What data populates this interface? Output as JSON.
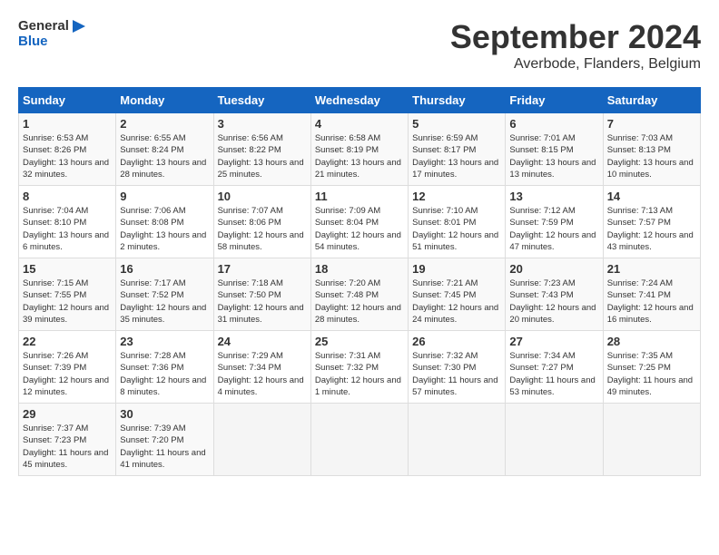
{
  "header": {
    "logo_line1": "General",
    "logo_line2": "Blue",
    "month": "September 2024",
    "location": "Averbode, Flanders, Belgium"
  },
  "days_of_week": [
    "Sunday",
    "Monday",
    "Tuesday",
    "Wednesday",
    "Thursday",
    "Friday",
    "Saturday"
  ],
  "weeks": [
    [
      {
        "day": "1",
        "sunrise": "6:53 AM",
        "sunset": "8:26 PM",
        "daylight": "13 hours and 32 minutes."
      },
      {
        "day": "2",
        "sunrise": "6:55 AM",
        "sunset": "8:24 PM",
        "daylight": "13 hours and 28 minutes."
      },
      {
        "day": "3",
        "sunrise": "6:56 AM",
        "sunset": "8:22 PM",
        "daylight": "13 hours and 25 minutes."
      },
      {
        "day": "4",
        "sunrise": "6:58 AM",
        "sunset": "8:19 PM",
        "daylight": "13 hours and 21 minutes."
      },
      {
        "day": "5",
        "sunrise": "6:59 AM",
        "sunset": "8:17 PM",
        "daylight": "13 hours and 17 minutes."
      },
      {
        "day": "6",
        "sunrise": "7:01 AM",
        "sunset": "8:15 PM",
        "daylight": "13 hours and 13 minutes."
      },
      {
        "day": "7",
        "sunrise": "7:03 AM",
        "sunset": "8:13 PM",
        "daylight": "13 hours and 10 minutes."
      }
    ],
    [
      {
        "day": "8",
        "sunrise": "7:04 AM",
        "sunset": "8:10 PM",
        "daylight": "13 hours and 6 minutes."
      },
      {
        "day": "9",
        "sunrise": "7:06 AM",
        "sunset": "8:08 PM",
        "daylight": "13 hours and 2 minutes."
      },
      {
        "day": "10",
        "sunrise": "7:07 AM",
        "sunset": "8:06 PM",
        "daylight": "12 hours and 58 minutes."
      },
      {
        "day": "11",
        "sunrise": "7:09 AM",
        "sunset": "8:04 PM",
        "daylight": "12 hours and 54 minutes."
      },
      {
        "day": "12",
        "sunrise": "7:10 AM",
        "sunset": "8:01 PM",
        "daylight": "12 hours and 51 minutes."
      },
      {
        "day": "13",
        "sunrise": "7:12 AM",
        "sunset": "7:59 PM",
        "daylight": "12 hours and 47 minutes."
      },
      {
        "day": "14",
        "sunrise": "7:13 AM",
        "sunset": "7:57 PM",
        "daylight": "12 hours and 43 minutes."
      }
    ],
    [
      {
        "day": "15",
        "sunrise": "7:15 AM",
        "sunset": "7:55 PM",
        "daylight": "12 hours and 39 minutes."
      },
      {
        "day": "16",
        "sunrise": "7:17 AM",
        "sunset": "7:52 PM",
        "daylight": "12 hours and 35 minutes."
      },
      {
        "day": "17",
        "sunrise": "7:18 AM",
        "sunset": "7:50 PM",
        "daylight": "12 hours and 31 minutes."
      },
      {
        "day": "18",
        "sunrise": "7:20 AM",
        "sunset": "7:48 PM",
        "daylight": "12 hours and 28 minutes."
      },
      {
        "day": "19",
        "sunrise": "7:21 AM",
        "sunset": "7:45 PM",
        "daylight": "12 hours and 24 minutes."
      },
      {
        "day": "20",
        "sunrise": "7:23 AM",
        "sunset": "7:43 PM",
        "daylight": "12 hours and 20 minutes."
      },
      {
        "day": "21",
        "sunrise": "7:24 AM",
        "sunset": "7:41 PM",
        "daylight": "12 hours and 16 minutes."
      }
    ],
    [
      {
        "day": "22",
        "sunrise": "7:26 AM",
        "sunset": "7:39 PM",
        "daylight": "12 hours and 12 minutes."
      },
      {
        "day": "23",
        "sunrise": "7:28 AM",
        "sunset": "7:36 PM",
        "daylight": "12 hours and 8 minutes."
      },
      {
        "day": "24",
        "sunrise": "7:29 AM",
        "sunset": "7:34 PM",
        "daylight": "12 hours and 4 minutes."
      },
      {
        "day": "25",
        "sunrise": "7:31 AM",
        "sunset": "7:32 PM",
        "daylight": "12 hours and 1 minute."
      },
      {
        "day": "26",
        "sunrise": "7:32 AM",
        "sunset": "7:30 PM",
        "daylight": "11 hours and 57 minutes."
      },
      {
        "day": "27",
        "sunrise": "7:34 AM",
        "sunset": "7:27 PM",
        "daylight": "11 hours and 53 minutes."
      },
      {
        "day": "28",
        "sunrise": "7:35 AM",
        "sunset": "7:25 PM",
        "daylight": "11 hours and 49 minutes."
      }
    ],
    [
      {
        "day": "29",
        "sunrise": "7:37 AM",
        "sunset": "7:23 PM",
        "daylight": "11 hours and 45 minutes."
      },
      {
        "day": "30",
        "sunrise": "7:39 AM",
        "sunset": "7:20 PM",
        "daylight": "11 hours and 41 minutes."
      },
      null,
      null,
      null,
      null,
      null
    ]
  ]
}
